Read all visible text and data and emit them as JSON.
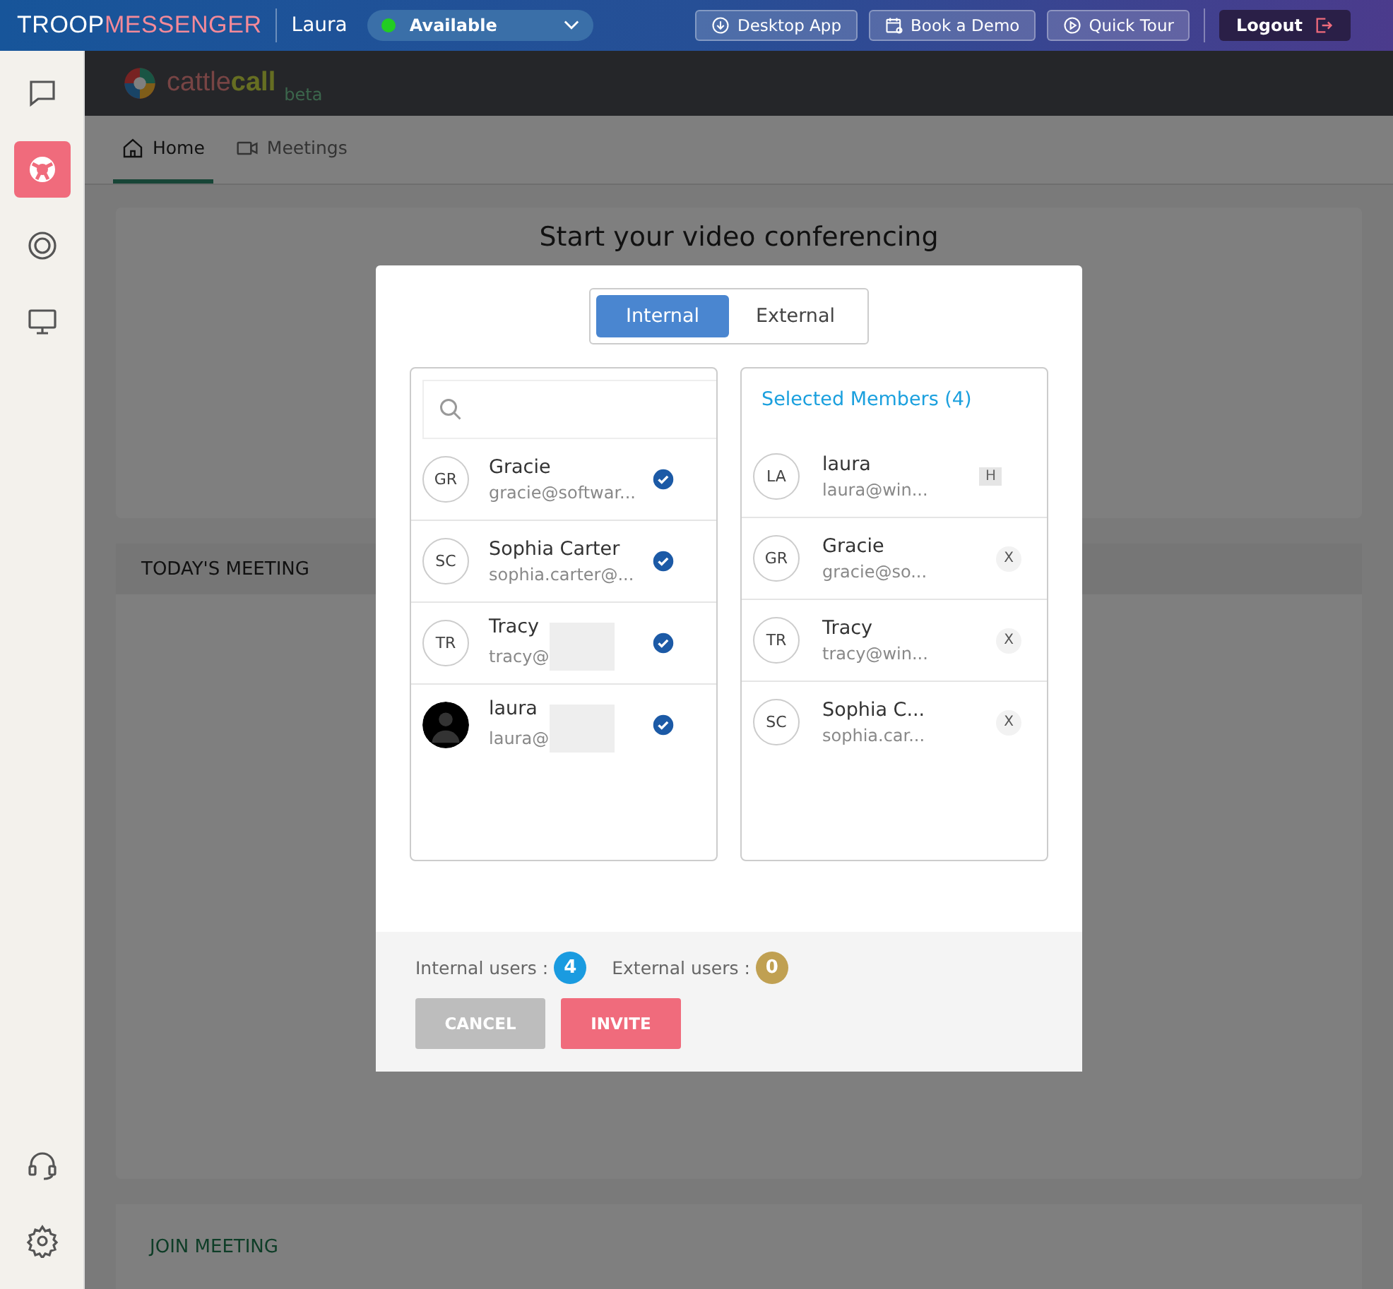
{
  "topbar": {
    "brand_a": "TROOP",
    "brand_b": "MESSENGER",
    "user": "Laura",
    "status": {
      "label": "Available",
      "color": "#22cc22"
    },
    "buttons": [
      "Desktop App",
      "Book a Demo",
      "Quick Tour"
    ],
    "logout": "Logout"
  },
  "sidebar": {
    "items": [
      {
        "selected": false
      },
      {
        "selected": true
      },
      {
        "selected": false
      },
      {
        "selected": false
      }
    ]
  },
  "app_header": {
    "brand_a": "cattle",
    "brand_b": "call",
    "suffix": "beta"
  },
  "tabs": [
    {
      "label": "Home",
      "selected": true
    },
    {
      "label": "Meetings",
      "selected": false
    }
  ],
  "page": {
    "heading": "Start your video conferencing",
    "today_title": "TODAY'S MEETING",
    "join_title": "JOIN MEETING"
  },
  "dialog": {
    "tabs": [
      {
        "label": "Internal",
        "selected": true
      },
      {
        "label": "External",
        "selected": false
      }
    ],
    "users": [
      {
        "kind": "initials",
        "initials": "GR",
        "name": "Gracie",
        "email": "gracie@softwar...",
        "redacted": false,
        "checked": true
      },
      {
        "kind": "initials",
        "initials": "SC",
        "name": "Sophia Carter",
        "email": "sophia.carter@...",
        "redacted": false,
        "checked": true
      },
      {
        "kind": "initials",
        "initials": "TR",
        "name": "Tracy",
        "email": "tracy@",
        "redacted": true,
        "checked": true
      },
      {
        "kind": "picture",
        "name": "laura",
        "email": "laura@",
        "redacted": true,
        "checked": true
      }
    ],
    "selected_title": "Selected Members (4)",
    "members": [
      {
        "initials": "LA",
        "name": "laura",
        "email": "laura@win...",
        "action": "H",
        "kind": "host"
      },
      {
        "initials": "GR",
        "name": "Gracie",
        "email": "gracie@so...",
        "action": "X",
        "kind": "remove"
      },
      {
        "initials": "TR",
        "name": "Tracy",
        "email": "tracy@win...",
        "action": "X",
        "kind": "remove"
      },
      {
        "initials": "SC",
        "name": "Sophia C...",
        "email": "sophia.car...",
        "action": "X",
        "kind": "remove"
      }
    ],
    "counts": [
      {
        "label": "Internal users :",
        "value": "4",
        "color": "#1a9be0"
      },
      {
        "label": "External users :",
        "value": "0",
        "color": "#c0a052"
      }
    ],
    "cancel": "CANCEL",
    "invite": "INVITE"
  }
}
